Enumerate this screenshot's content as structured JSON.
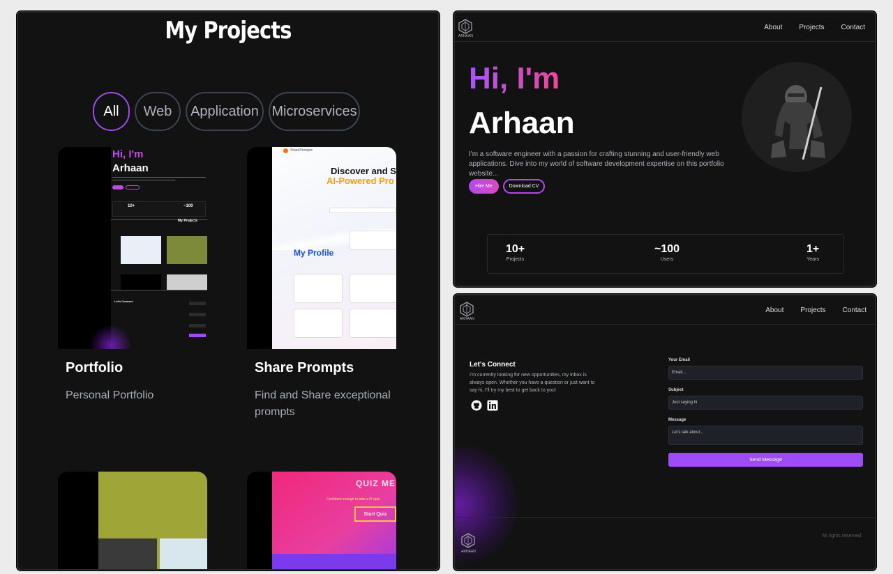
{
  "projects": {
    "title": "My Projects",
    "filters": [
      "All",
      "Web",
      "Application",
      "Microservices"
    ],
    "cards": [
      {
        "title": "Portfolio",
        "desc": "Personal Portfolio"
      },
      {
        "title": "Share Prompts",
        "desc": "Find and Share exceptional prompts"
      }
    ],
    "thumb_portfolio": {
      "hi": "Hi, I'm",
      "name": "Arhaan",
      "subtitle": "My Projects",
      "connect": "Let's Connect",
      "stat1": "10+",
      "stat2": "~100"
    },
    "thumb_share": {
      "line1": "Discover and S",
      "line2": "AI-Powered Pro",
      "profile": "My Profile",
      "brand": "SharePrompts"
    },
    "thumb_quiz": {
      "title": "QUIZ ME",
      "tagline": "Confident enough to take a lil' quiz",
      "button": "Start Quiz"
    }
  },
  "hero": {
    "nav": {
      "brand": "ARHAAN",
      "links": [
        "About",
        "Projects",
        "Contact"
      ]
    },
    "hi": "Hi, I'm",
    "name": "Arhaan",
    "description": "I'm a software engineer with a passion for crafting stunning and user-friendly web applications. Dive into my world of software development expertise on this portfolio website...",
    "hire_label": "Hire Me",
    "cv_label": "Download CV",
    "stats": [
      {
        "value": "10+",
        "label": "Projects"
      },
      {
        "value": "~100",
        "label": "Users"
      },
      {
        "value": "1+",
        "label": "Years"
      }
    ]
  },
  "contact": {
    "nav": {
      "brand": "ARHAAN",
      "links": [
        "About",
        "Projects",
        "Contact"
      ]
    },
    "title": "Let's Connect",
    "description": "I'm currently looking for new opportunities, my inbox is always open. Whether you have a question or just want to say hi, I'll try my best to get back to you!",
    "email_label": "Your Email",
    "email_placeholder": "Email...",
    "subject_label": "Subject",
    "subject_value": "Just saying hi",
    "message_label": "Message",
    "message_placeholder": "Let's talk about...",
    "send_label": "Send Message",
    "rights": "All rights reserved.",
    "footer_brand": "ARHAAN"
  },
  "colors": {
    "accent": "#9d4df3",
    "pink": "#ec4899",
    "bg": "#121212"
  }
}
